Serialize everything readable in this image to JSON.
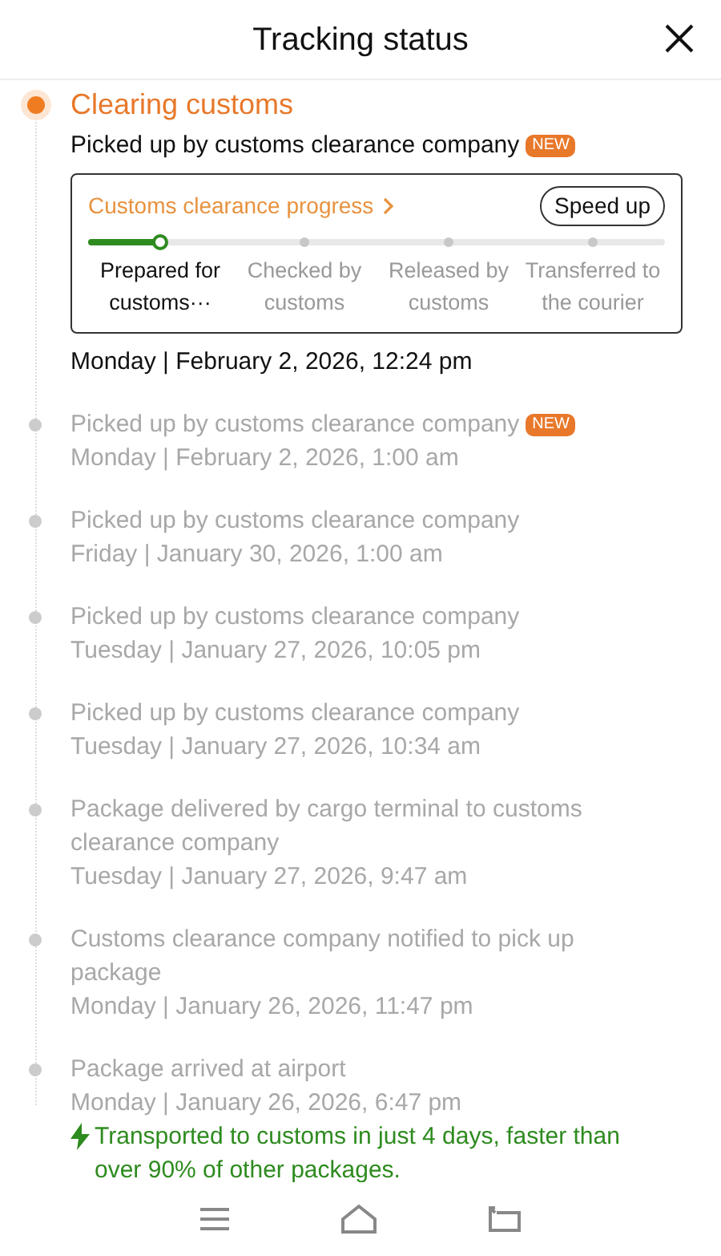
{
  "header": {
    "title": "Tracking status"
  },
  "current": {
    "status": "Clearing customs",
    "event": "Picked up by customs clearance company",
    "badge": "NEW",
    "date": "Monday | February 2, 2026, 12:24 pm",
    "progress": {
      "title": "Customs clearance progress",
      "button": "Speed up",
      "level": 0.125,
      "steps": [
        {
          "label": "Prepared for customs···",
          "selected": true
        },
        {
          "label": "Checked by customs",
          "selected": false
        },
        {
          "label": "Released by customs",
          "selected": false
        },
        {
          "label": "Transferred to the courier",
          "selected": false
        }
      ]
    }
  },
  "events": [
    {
      "text": "Picked up by customs clearance company",
      "badge": "NEW",
      "date": "Monday | February 2, 2026, 1:00 am"
    },
    {
      "text": "Picked up by customs clearance company",
      "date": "Friday | January 30, 2026, 1:00 am"
    },
    {
      "text": "Picked up by customs clearance company",
      "date": "Tuesday | January 27, 2026, 10:05 pm"
    },
    {
      "text": "Picked up by customs clearance company",
      "date": "Tuesday | January 27, 2026, 10:34 am"
    },
    {
      "text": "Package delivered by cargo terminal to customs clearance company",
      "date": "Tuesday | January 27, 2026, 9:47 am"
    },
    {
      "text": "Customs clearance company notified to pick up package",
      "date": "Monday | January 26, 2026, 11:47 pm"
    },
    {
      "text": "Package arrived at airport",
      "date": "Monday | January 26, 2026, 6:47 pm",
      "note": "Transported to customs in just 4 days, faster than over 90% of other packages."
    }
  ]
}
